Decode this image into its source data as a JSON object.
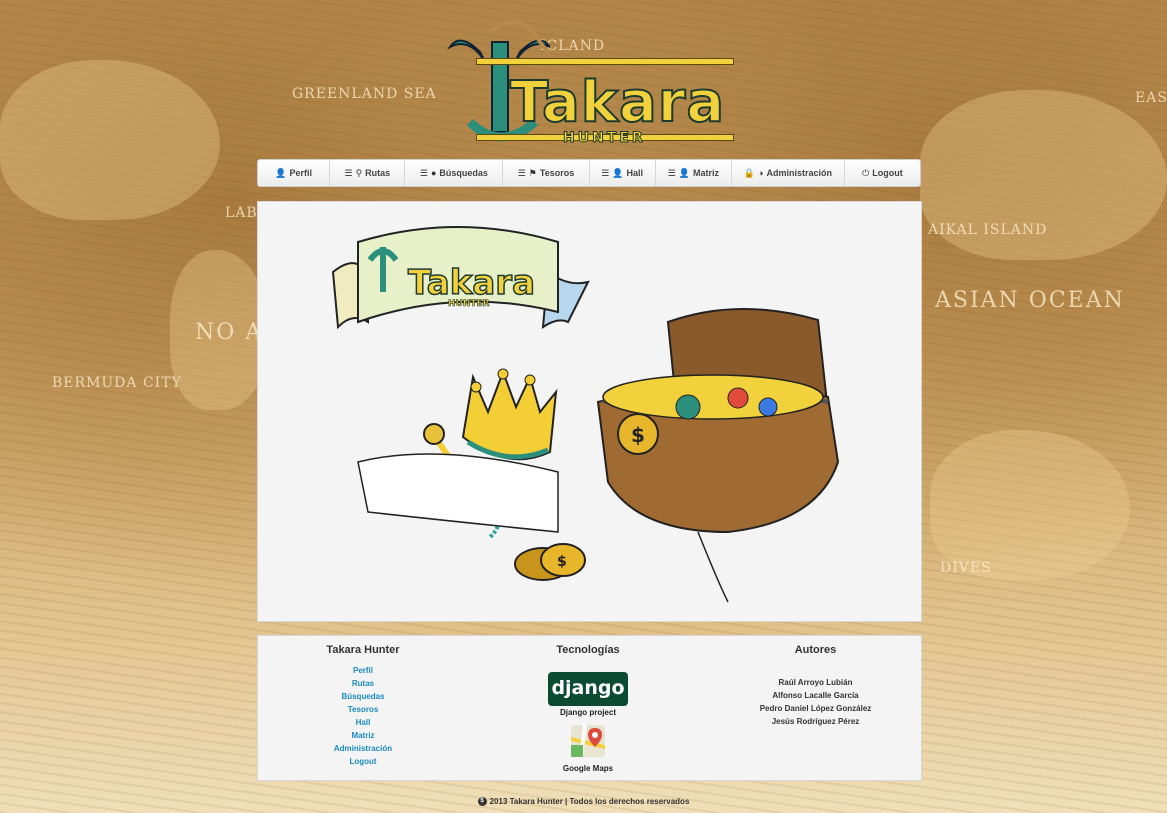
{
  "brand": {
    "name": "Takara",
    "subtitle": "HUNTER"
  },
  "nav": [
    {
      "label": "Perfil",
      "icons": [
        "user-icon"
      ]
    },
    {
      "label": "Rutas",
      "icons": [
        "list-icon",
        "map-marker-icon"
      ]
    },
    {
      "label": "Búsquedas",
      "icons": [
        "list-icon",
        "globe-icon"
      ]
    },
    {
      "label": "Tesoros",
      "icons": [
        "list-icon",
        "flag-icon"
      ]
    },
    {
      "label": "Hall",
      "icons": [
        "list-icon",
        "user-icon"
      ]
    },
    {
      "label": "Matriz",
      "icons": [
        "list-icon",
        "user-icon"
      ]
    },
    {
      "label": "Administración",
      "icons": [
        "lock-icon",
        "half-circle-icon"
      ]
    },
    {
      "label": "Logout",
      "icons": [
        "power-icon"
      ]
    }
  ],
  "hero": {
    "banner_word": "Takara",
    "banner_sub": "HUNTER"
  },
  "footer": {
    "col1": {
      "title": "Takara Hunter",
      "links": [
        "Perfil",
        "Rutas",
        "Búsquedas",
        "Tesoros",
        "Hall",
        "Matriz",
        "Administración",
        "Logout"
      ]
    },
    "col2": {
      "title": "Tecnologías",
      "django_logo": "django",
      "django_caption": "Django project",
      "maps_caption": "Google Maps"
    },
    "col3": {
      "title": "Autores",
      "authors": [
        "Raúl Arroyo Lubián",
        "Alfonso Lacalle García",
        "Pedro Daniel López González",
        "Jesús Rodríguez Pérez"
      ]
    }
  },
  "copyright": "2013 Takara Hunter | Todos los derechos reservados",
  "map_labels": [
    "GREENLAND SEA",
    "ICLAND",
    "BERMUDA CITY",
    "NO ATLA STA",
    "LAB",
    "AIKAL ISLAND",
    "ASIAN OCEAN",
    "EAST",
    "DIVES"
  ],
  "colors": {
    "accent": "#1a8ac6",
    "logo_yellow": "#f2d23c",
    "anchor": "#2c8f7c",
    "django": "#0c4b33"
  }
}
